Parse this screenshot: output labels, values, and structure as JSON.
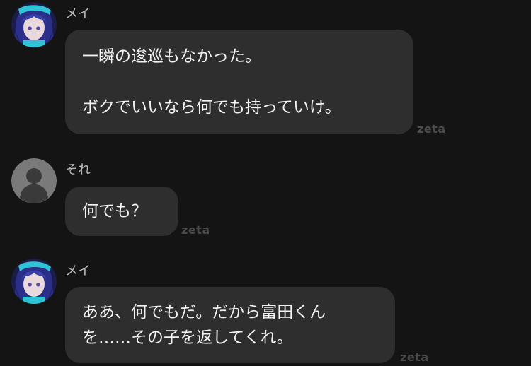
{
  "messages": [
    {
      "sender": "メイ",
      "avatar": "anime-character-avatar",
      "text": "一瞬の逡巡もなかった。\n\nボクでいいなら何でも持っていけ。",
      "watermark": "zeta"
    },
    {
      "sender": "それ",
      "avatar": "default-user-avatar",
      "text": "何でも？",
      "watermark": "zeta"
    },
    {
      "sender": "メイ",
      "avatar": "anime-character-avatar",
      "text": "ああ、何でもだ。だから富田くん\nを……その子を返してくれ。",
      "watermark": "zeta"
    }
  ],
  "colors": {
    "background": "#141414",
    "bubble": "#2e2e2e",
    "text": "#f2f2f2",
    "sender": "#b9b9b9",
    "watermark": "#4a4a4a",
    "avatar_accent": "#2ec4d6",
    "avatar_hair": "#2b2f8a"
  }
}
